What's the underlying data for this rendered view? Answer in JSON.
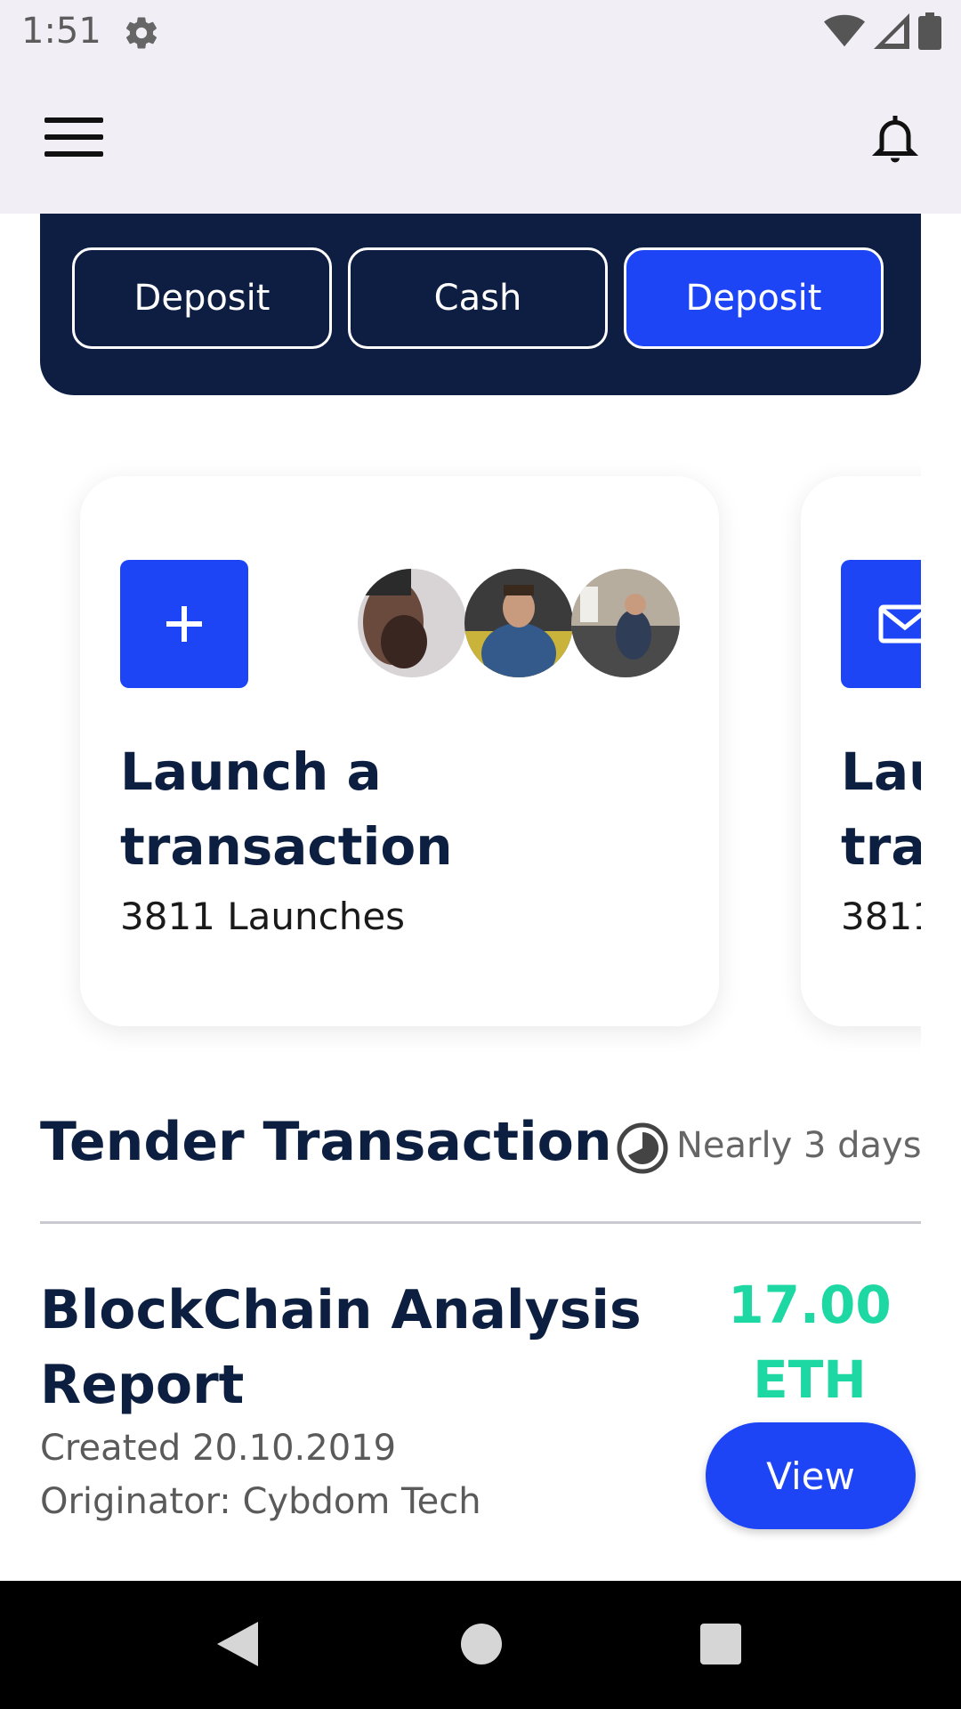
{
  "status_bar": {
    "time": "1:51"
  },
  "tabs": [
    {
      "label": "Deposit",
      "active": false
    },
    {
      "label": "Cash",
      "active": false
    },
    {
      "label": "Deposit",
      "active": true
    }
  ],
  "cards": [
    {
      "title_line1": "Launch a",
      "title_line2": "transaction",
      "subtitle": "3811 Launches",
      "icon": "plus-icon"
    },
    {
      "title_line1": "Lau",
      "title_line2": "tra",
      "subtitle": "3811",
      "icon": "mail-icon"
    }
  ],
  "section": {
    "title": "Tender Transaction",
    "duration": "Nearly 3 days"
  },
  "transaction": {
    "title_line1": "BlockChain Analysis",
    "title_line2": "Report",
    "created": "Created 20.10.2019",
    "originator": "Originator: Cybdom Tech",
    "amount_value": "17.00",
    "amount_unit": "ETH",
    "view_label": "View"
  },
  "colors": {
    "primary": "#1d44f5",
    "dark": "#0e1e42",
    "accent": "#1ed8a4"
  }
}
